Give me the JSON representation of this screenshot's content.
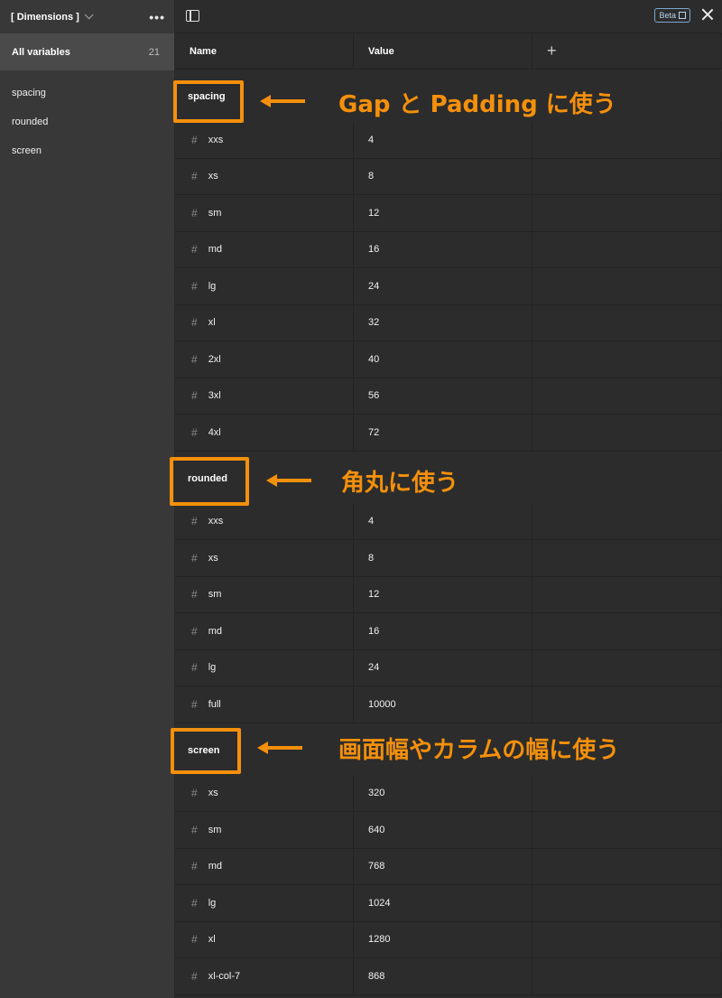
{
  "sidebar": {
    "collection_name": "[ Dimensions ]",
    "all_variables_label": "All variables",
    "all_variables_count": "21",
    "groups": [
      {
        "label": "spacing"
      },
      {
        "label": "rounded"
      },
      {
        "label": "screen"
      }
    ]
  },
  "topbar": {
    "beta_label": "Beta"
  },
  "table": {
    "columns": [
      "Name",
      "Value"
    ],
    "add_column_label": "+",
    "groups": [
      {
        "label": "spacing",
        "rows": [
          {
            "name": "xxs",
            "value": "4"
          },
          {
            "name": "xs",
            "value": "8"
          },
          {
            "name": "sm",
            "value": "12"
          },
          {
            "name": "md",
            "value": "16"
          },
          {
            "name": "lg",
            "value": "24"
          },
          {
            "name": "xl",
            "value": "32"
          },
          {
            "name": "2xl",
            "value": "40"
          },
          {
            "name": "3xl",
            "value": "56"
          },
          {
            "name": "4xl",
            "value": "72"
          }
        ]
      },
      {
        "label": "rounded",
        "rows": [
          {
            "name": "xxs",
            "value": "4"
          },
          {
            "name": "xs",
            "value": "8"
          },
          {
            "name": "sm",
            "value": "12"
          },
          {
            "name": "md",
            "value": "16"
          },
          {
            "name": "lg",
            "value": "24"
          },
          {
            "name": "full",
            "value": "10000"
          }
        ]
      },
      {
        "label": "screen",
        "rows": [
          {
            "name": "xs",
            "value": "320"
          },
          {
            "name": "sm",
            "value": "640"
          },
          {
            "name": "md",
            "value": "768"
          },
          {
            "name": "lg",
            "value": "1024"
          },
          {
            "name": "xl",
            "value": "1280"
          },
          {
            "name": "xl-col-7",
            "value": "868"
          }
        ]
      }
    ]
  },
  "annotations": {
    "spacing_note": "Gap と Padding に使う",
    "rounded_note": "角丸に使う",
    "screen_note": "画面幅やカラムの幅に使う",
    "color": "#f4900b"
  },
  "icons": {
    "variable_type": "hash-icon",
    "hash_glyph": "#"
  }
}
